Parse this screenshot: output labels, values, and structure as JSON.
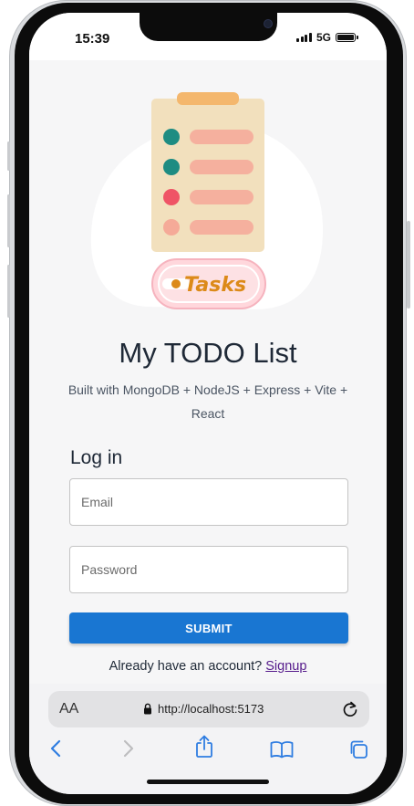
{
  "status_bar": {
    "time": "15:39",
    "network": "5G"
  },
  "app": {
    "illustration_label": "Tasks",
    "title": "My TODO List",
    "subtitle": "Built with MongoDB + NodeJS + Express + Vite + React"
  },
  "login": {
    "heading": "Log in",
    "email_placeholder": "Email",
    "password_placeholder": "Password",
    "submit_label": "SUBMIT",
    "signup_prompt": "Already have an account?",
    "signup_link": "Signup"
  },
  "browser": {
    "text_size_label": "AA",
    "url": "http://localhost:5173",
    "icons": [
      "back-icon",
      "forward-icon",
      "share-icon",
      "bookmarks-icon",
      "tabs-icon",
      "reload-icon",
      "lock-icon"
    ]
  },
  "colors": {
    "accent": "#1976d2",
    "link": "#551a8b",
    "clipboard_body": "#f2e0bd",
    "clipboard_clip": "#f4b76d",
    "dot_teal": "#1e8c82",
    "dot_red": "#ef5466",
    "dot_peach": "#f5aa98",
    "tasks_text": "#dc8a19",
    "tasks_badge": "#ffd7dc"
  }
}
